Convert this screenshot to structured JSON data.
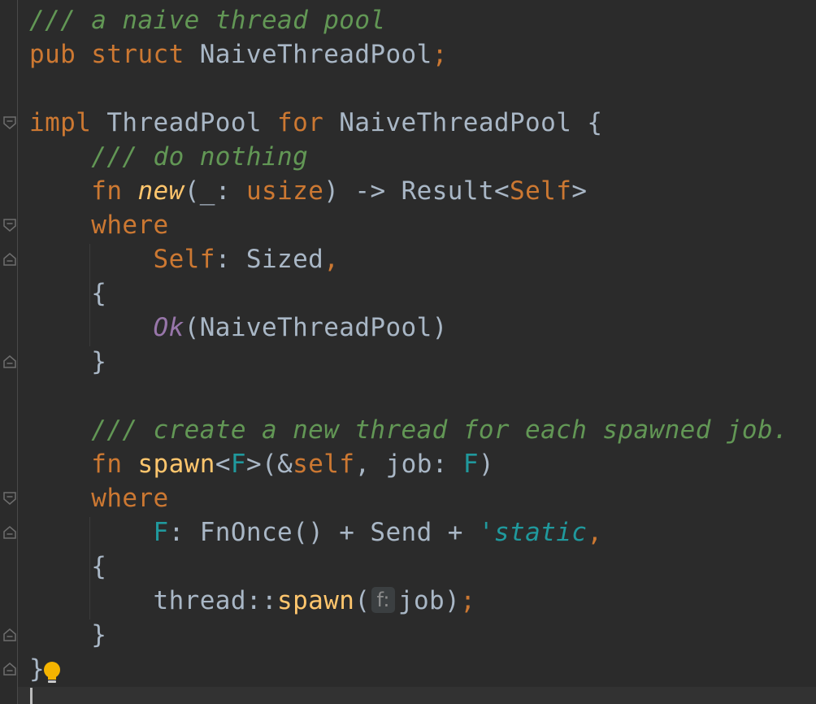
{
  "editor": {
    "language": "Rust",
    "colors": {
      "background": "#2b2b2b",
      "keyword": "#cc7832",
      "doc_comment": "#629755",
      "identifier": "#a9b7c6",
      "function": "#ffc66d",
      "enum_variant": "#9876aa",
      "type_param": "#20999d"
    },
    "lines": [
      {
        "tokens": [
          {
            "t": "/// a naive thread pool",
            "c": "doc"
          }
        ]
      },
      {
        "tokens": [
          {
            "t": "pub",
            "c": "k"
          },
          {
            "t": " ",
            "c": "plain"
          },
          {
            "t": "struct",
            "c": "k"
          },
          {
            "t": " NaiveThreadPool",
            "c": "plain"
          },
          {
            "t": ";",
            "c": "k"
          }
        ]
      },
      {
        "tokens": []
      },
      {
        "tokens": [
          {
            "t": "impl",
            "c": "k"
          },
          {
            "t": " ThreadPool ",
            "c": "plain"
          },
          {
            "t": "for",
            "c": "k"
          },
          {
            "t": " NaiveThreadPool {",
            "c": "plain"
          }
        ]
      },
      {
        "tokens": [
          {
            "t": "    ",
            "c": "plain"
          },
          {
            "t": "/// do nothing",
            "c": "doc"
          }
        ]
      },
      {
        "tokens": [
          {
            "t": "    ",
            "c": "plain"
          },
          {
            "t": "fn",
            "c": "k"
          },
          {
            "t": " ",
            "c": "plain"
          },
          {
            "t": "new",
            "c": "fnit"
          },
          {
            "t": "(_: ",
            "c": "plain"
          },
          {
            "t": "usize",
            "c": "k"
          },
          {
            "t": ") -> Result<",
            "c": "plain"
          },
          {
            "t": "Self",
            "c": "k"
          },
          {
            "t": ">",
            "c": "plain"
          }
        ]
      },
      {
        "tokens": [
          {
            "t": "    ",
            "c": "plain"
          },
          {
            "t": "where",
            "c": "k"
          }
        ]
      },
      {
        "tokens": [
          {
            "t": "        ",
            "c": "plain"
          },
          {
            "t": "Self",
            "c": "k"
          },
          {
            "t": ": Sized",
            "c": "plain"
          },
          {
            "t": ",",
            "c": "k"
          }
        ]
      },
      {
        "tokens": [
          {
            "t": "    {",
            "c": "plain"
          }
        ]
      },
      {
        "tokens": [
          {
            "t": "        ",
            "c": "plain"
          },
          {
            "t": "Ok",
            "c": "enumv"
          },
          {
            "t": "(NaiveThreadPool)",
            "c": "plain"
          }
        ]
      },
      {
        "tokens": [
          {
            "t": "    }",
            "c": "plain"
          }
        ]
      },
      {
        "tokens": []
      },
      {
        "tokens": [
          {
            "t": "    ",
            "c": "plain"
          },
          {
            "t": "/// create a new thread for each spawned job.",
            "c": "doc"
          }
        ]
      },
      {
        "tokens": [
          {
            "t": "    ",
            "c": "plain"
          },
          {
            "t": "fn",
            "c": "k"
          },
          {
            "t": " ",
            "c": "plain"
          },
          {
            "t": "spawn",
            "c": "fnname"
          },
          {
            "t": "<",
            "c": "plain"
          },
          {
            "t": "F",
            "c": "tparam"
          },
          {
            "t": ">(&",
            "c": "plain"
          },
          {
            "t": "self",
            "c": "k"
          },
          {
            "t": ", job: ",
            "c": "plain"
          },
          {
            "t": "F",
            "c": "tparam"
          },
          {
            "t": ")",
            "c": "plain"
          }
        ]
      },
      {
        "tokens": [
          {
            "t": "    ",
            "c": "plain"
          },
          {
            "t": "where",
            "c": "k"
          }
        ]
      },
      {
        "tokens": [
          {
            "t": "        ",
            "c": "plain"
          },
          {
            "t": "F",
            "c": "tparam"
          },
          {
            "t": ": FnOnce() + Send + ",
            "c": "plain"
          },
          {
            "t": "'static",
            "c": "life"
          },
          {
            "t": ",",
            "c": "k"
          }
        ]
      },
      {
        "tokens": [
          {
            "t": "    {",
            "c": "plain"
          }
        ]
      },
      {
        "tokens": [
          {
            "t": "        thread::",
            "c": "plain"
          },
          {
            "t": "spawn",
            "c": "fnname"
          },
          {
            "t": "(",
            "c": "plain"
          },
          {
            "t": "f:",
            "c": "hint"
          },
          {
            "t": "job)",
            "c": "plain"
          },
          {
            "t": ";",
            "c": "k"
          }
        ]
      },
      {
        "tokens": [
          {
            "t": "    }",
            "c": "plain"
          }
        ]
      },
      {
        "tokens": [
          {
            "t": "}",
            "c": "plain"
          }
        ]
      }
    ]
  },
  "gutter": {
    "fold_markers": [
      {
        "line": 3,
        "kind": "fold-open-icon"
      },
      {
        "line": 6,
        "kind": "fold-open-icon"
      },
      {
        "line": 7,
        "kind": "fold-end-icon"
      },
      {
        "line": 10,
        "kind": "fold-end-icon"
      },
      {
        "line": 14,
        "kind": "fold-open-icon"
      },
      {
        "line": 15,
        "kind": "fold-end-icon"
      },
      {
        "line": 18,
        "kind": "fold-end-icon"
      },
      {
        "line": 19,
        "kind": "fold-end-icon"
      }
    ]
  },
  "intention": {
    "icon": "lightbulb-icon"
  }
}
